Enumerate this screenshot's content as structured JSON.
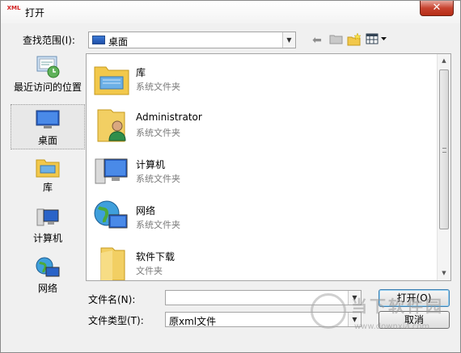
{
  "window": {
    "title": "打开",
    "app_icon_text": "XML"
  },
  "lookin": {
    "label": "查找范围(I):",
    "value": "桌面"
  },
  "toolbar": {
    "icons": [
      "back-arrow-icon",
      "up-folder-icon",
      "new-folder-icon",
      "view-menu-icon"
    ]
  },
  "sidebar": {
    "items": [
      {
        "label": "最近访问的位置",
        "icon": "recent-places-icon"
      },
      {
        "label": "桌面",
        "icon": "desktop-icon",
        "selected": true
      },
      {
        "label": "库",
        "icon": "libraries-icon"
      },
      {
        "label": "计算机",
        "icon": "computer-icon"
      },
      {
        "label": "网络",
        "icon": "network-icon"
      }
    ]
  },
  "files": [
    {
      "name": "库",
      "type": "系统文件夹",
      "icon": "libraries-folder-icon"
    },
    {
      "name": "Administrator",
      "type": "系统文件夹",
      "icon": "user-folder-icon"
    },
    {
      "name": "计算机",
      "type": "系统文件夹",
      "icon": "computer-icon"
    },
    {
      "name": "网络",
      "type": "系统文件夹",
      "icon": "network-icon"
    },
    {
      "name": "软件下载",
      "type": "文件夹",
      "icon": "folder-icon"
    }
  ],
  "filename": {
    "label": "文件名(N):",
    "value": ""
  },
  "filetype": {
    "label": "文件类型(T):",
    "value": "原xml文件"
  },
  "buttons": {
    "open": "打开(O)",
    "cancel": "取消"
  },
  "watermark": {
    "text": "当下软件园",
    "url": "www.downxia.com"
  },
  "colors": {
    "accent": "#3c7fb1",
    "close": "#c7432f",
    "folder": "#f2c84b"
  }
}
